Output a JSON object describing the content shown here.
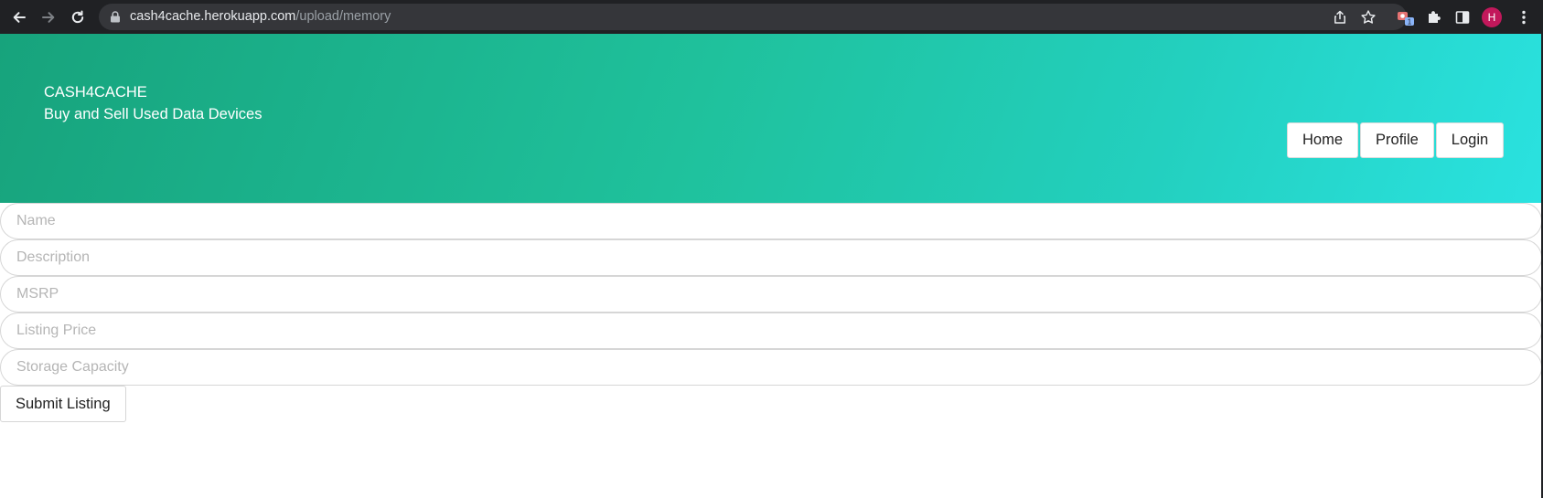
{
  "browser": {
    "url_host": "cash4cache.herokuapp.com",
    "url_path": "/upload/memory",
    "extension_badge": "1",
    "profile_initial": "H",
    "icons": [
      "back-arrow-icon",
      "forward-arrow-icon",
      "reload-icon",
      "lock-icon",
      "share-icon",
      "star-icon",
      "extension-badge-icon",
      "puzzle-icon",
      "sidepanel-icon",
      "kebab-menu-icon"
    ]
  },
  "header": {
    "brand": "CASH4CACHE",
    "tagline": "Buy and Sell Used Data Devices",
    "nav": [
      {
        "label": "Home"
      },
      {
        "label": "Profile"
      },
      {
        "label": "Login"
      }
    ]
  },
  "form": {
    "fields": [
      {
        "placeholder": "Name",
        "value": ""
      },
      {
        "placeholder": "Description",
        "value": ""
      },
      {
        "placeholder": "MSRP",
        "value": ""
      },
      {
        "placeholder": "Listing Price",
        "value": ""
      },
      {
        "placeholder": "Storage Capacity",
        "value": ""
      }
    ],
    "submit_label": "Submit Listing"
  },
  "colors": {
    "hero_start": "#17a37c",
    "hero_end": "#2ae2e0",
    "chrome_bg": "#202124",
    "avatar": "#c2185b"
  }
}
